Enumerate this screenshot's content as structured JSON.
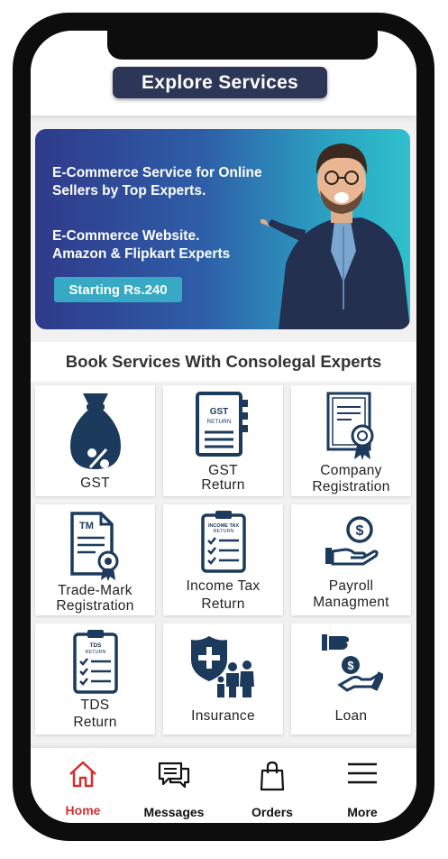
{
  "header": {
    "title": "Explore Services"
  },
  "banner": {
    "line1": "E-Commerce Service for Online",
    "line2": "Sellers by Top Experts.",
    "line3": "E-Commerce Website.",
    "line4": "Amazon & Flipkart Experts",
    "button_label": "Starting Rs.240"
  },
  "section": {
    "heading": "Book Services With Consolegal Experts"
  },
  "services": [
    {
      "line1": "GST",
      "line2": "",
      "icon": "money-bag-percent-icon"
    },
    {
      "line1": "GST",
      "line2": "Return",
      "icon": "gst-return-document-icon"
    },
    {
      "line1": "Company",
      "line2": "Registration",
      "icon": "certificate-icon"
    },
    {
      "line1": "Trade-Mark",
      "line2": "Registration",
      "icon": "trademark-document-icon"
    },
    {
      "line1": "Income Tax",
      "line2": "Return",
      "icon": "income-tax-clipboard-icon"
    },
    {
      "line1": "Payroll",
      "line2": "Managment",
      "icon": "hand-coin-icon"
    },
    {
      "line1": "TDS",
      "line2": "Return",
      "icon": "tds-clipboard-icon"
    },
    {
      "line1": "Insurance",
      "line2": "",
      "icon": "shield-family-icon"
    },
    {
      "line1": "Loan",
      "line2": "",
      "icon": "loan-hand-icon"
    }
  ],
  "icon_texts": {
    "gst_doc": "GST",
    "gst_doc_sub": "RETURN",
    "tm": "TM",
    "income_tax": "INCOME TAX",
    "income_tax_sub": "RETURN",
    "tds": "TDS",
    "tds_sub": "RETURN"
  },
  "nav": {
    "home": "Home",
    "messages": "Messages",
    "orders": "Orders",
    "more": "More"
  },
  "colors": {
    "icon_navy": "#1b3a5c",
    "active_red": "#d32f2f",
    "title_pill": "#2c3656"
  }
}
